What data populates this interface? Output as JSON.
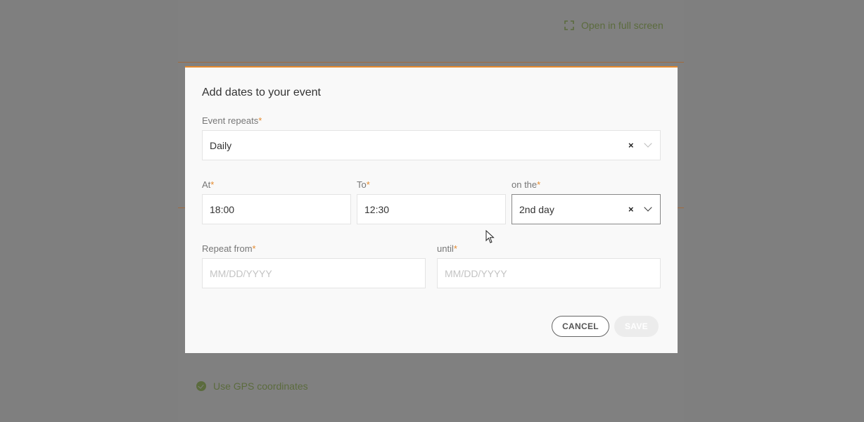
{
  "background": {
    "fullscreen_link": "Open in full screen",
    "gps_label": "Use GPS coordinates"
  },
  "modal": {
    "title": "Add dates to your event",
    "repeats": {
      "label": "Event repeats",
      "required": "*",
      "value": "Daily",
      "clear": "×"
    },
    "at": {
      "label": "At",
      "required": "*",
      "value": "18:00"
    },
    "to": {
      "label": "To",
      "required": "*",
      "value": "12:30"
    },
    "on_the": {
      "label": "on the",
      "required": "*",
      "value": "2nd day",
      "clear": "×"
    },
    "repeat_from": {
      "label": "Repeat from",
      "required": "*",
      "placeholder": "MM/DD/YYYY"
    },
    "until": {
      "label": "until",
      "required": "*",
      "placeholder": "MM/DD/YYYY"
    },
    "cancel_label": "CANCEL",
    "save_label": "SAVE"
  },
  "colors": {
    "accent": "#e58a2e",
    "overlay": "#7f7f7f",
    "green_link": "#5b6b3d"
  }
}
